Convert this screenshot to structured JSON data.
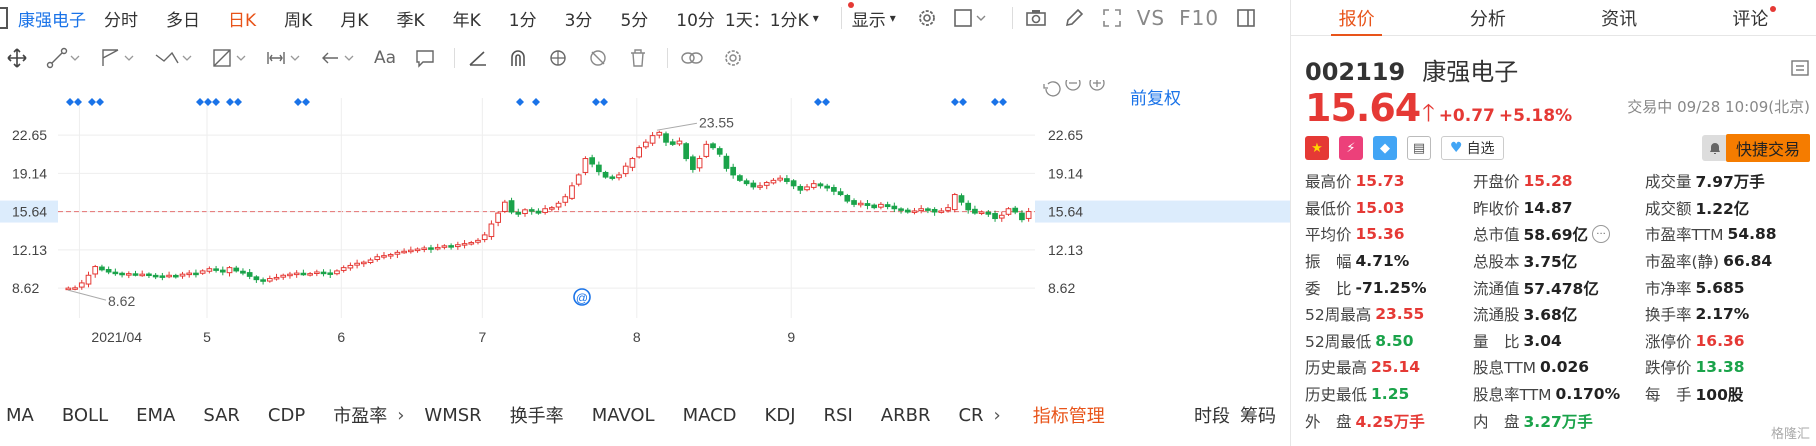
{
  "toolbar": {
    "stock_name": "康强电子",
    "periods": [
      "分时",
      "多日",
      "日K",
      "周K",
      "月K",
      "季K",
      "年K",
      "1分",
      "3分",
      "5分",
      "10分"
    ],
    "active_period": "日K",
    "interval_select": "1天：1分K",
    "display_select": "显示",
    "vs_label": "VS",
    "f10_label": "F10"
  },
  "chart": {
    "adjust_label": "前复权",
    "y_ticks": [
      "22.65",
      "19.14",
      "15.64",
      "12.13",
      "8.62"
    ],
    "current_price_tag": "15.64",
    "x_ticks": [
      "2021/04",
      "5",
      "6",
      "7",
      "8",
      "9"
    ],
    "high_annotation": "23.55",
    "low_annotation": "8.62",
    "event_marker": "@"
  },
  "chart_data": {
    "type": "candlestick",
    "title": "",
    "xlabel": "",
    "ylabel": "",
    "ylim": [
      6.8,
      25.5
    ],
    "x_ticks": [
      "2021/04",
      "5",
      "6",
      "7",
      "8",
      "9"
    ],
    "y_ticks": [
      8.62,
      12.13,
      15.64,
      19.14,
      22.65
    ],
    "reference_line": 15.64,
    "annotations": {
      "max": 23.55,
      "min": 8.62
    },
    "colors": {
      "up": "#e53935",
      "down": "#1aa34a"
    },
    "closes": [
      8.62,
      8.65,
      9.1,
      9.8,
      10.6,
      10.3,
      10.1,
      10.0,
      9.9,
      9.95,
      9.85,
      9.9,
      9.8,
      9.75,
      9.7,
      9.8,
      9.7,
      9.9,
      10.0,
      9.95,
      10.2,
      10.4,
      10.3,
      10.1,
      10.5,
      10.2,
      10.0,
      9.7,
      9.4,
      9.3,
      9.5,
      9.6,
      9.8,
      9.9,
      10.0,
      9.9,
      9.95,
      10.1,
      10.0,
      9.9,
      10.2,
      10.5,
      10.7,
      10.9,
      11.0,
      11.2,
      11.5,
      11.6,
      11.7,
      11.9,
      12.0,
      12.1,
      12.2,
      12.3,
      12.2,
      12.35,
      12.5,
      12.4,
      12.6,
      12.7,
      12.8,
      13.0,
      13.5,
      14.5,
      15.5,
      16.5,
      15.6,
      15.4,
      15.8,
      15.7,
      15.5,
      15.9,
      16.0,
      16.4,
      17.0,
      18.0,
      19.0,
      20.5,
      20.0,
      19.3,
      18.8,
      18.7,
      19.0,
      19.8,
      20.5,
      21.5,
      22.0,
      22.6,
      22.9,
      22.0,
      21.8,
      22.1,
      20.5,
      19.5,
      20.5,
      21.8,
      21.5,
      20.9,
      19.6,
      19.0,
      18.5,
      18.2,
      17.9,
      18.0,
      18.3,
      18.5,
      18.7,
      18.4,
      18.0,
      17.6,
      17.9,
      18.2,
      18.0,
      17.8,
      17.5,
      17.2,
      16.6,
      16.3,
      16.4,
      16.2,
      16.0,
      16.3,
      16.1,
      15.9,
      15.8,
      15.6,
      15.7,
      15.9,
      15.8,
      15.6,
      15.7,
      16.0,
      17.2,
      16.5,
      15.8,
      15.5,
      15.6,
      15.4,
      15.0,
      15.3,
      15.9,
      15.6,
      14.9,
      15.64
    ]
  },
  "indicators": {
    "items": [
      "MA",
      "BOLL",
      "EMA",
      "SAR",
      "CDP",
      "市盈率",
      "WMSR",
      "换手率",
      "MAVOL",
      "MACD",
      "KDJ",
      "RSI",
      "ARBR",
      "CR"
    ],
    "manage": "指标管理",
    "right_items": [
      "时段",
      "筹码"
    ]
  },
  "quote": {
    "tabs": [
      "报价",
      "分析",
      "资讯",
      "评论"
    ],
    "code": "002119",
    "name": "康强电子",
    "price": "15.64",
    "change": "+0.77",
    "change_pct": "+5.18%",
    "status": "交易中 09/28 10:09(北京)",
    "fav_label": "自选",
    "trade_label": "快捷交易",
    "stats": [
      [
        {
          "label": "最高价",
          "value": "15.73",
          "tone": "up"
        },
        {
          "label": "开盘价",
          "value": "15.28",
          "tone": "up"
        },
        {
          "label": "成交量",
          "value": "7.97万手",
          "tone": "neu"
        }
      ],
      [
        {
          "label": "最低价",
          "value": "15.03",
          "tone": "up"
        },
        {
          "label": "昨收价",
          "value": "14.87",
          "tone": "neu"
        },
        {
          "label": "成交额",
          "value": "1.22亿",
          "tone": "neu"
        }
      ],
      [
        {
          "label": "平均价",
          "value": "15.36",
          "tone": "up"
        },
        {
          "label": "总市值",
          "value": "58.69亿",
          "tone": "neu",
          "more": true
        },
        {
          "label": "市盈率TTM",
          "value": "54.88",
          "tone": "neu"
        }
      ],
      [
        {
          "label": "振　幅",
          "value": "4.71%",
          "tone": "neu"
        },
        {
          "label": "总股本",
          "value": "3.75亿",
          "tone": "neu"
        },
        {
          "label": "市盈率(静)",
          "value": "66.84",
          "tone": "neu"
        }
      ],
      [
        {
          "label": "委　比",
          "value": "-71.25%",
          "tone": "neu"
        },
        {
          "label": "流通值",
          "value": "57.478亿",
          "tone": "neu"
        },
        {
          "label": "市净率",
          "value": "5.685",
          "tone": "neu"
        }
      ],
      [
        {
          "label": "52周最高",
          "value": "23.55",
          "tone": "up"
        },
        {
          "label": "流通股",
          "value": "3.68亿",
          "tone": "neu"
        },
        {
          "label": "换手率",
          "value": "2.17%",
          "tone": "neu"
        }
      ],
      [
        {
          "label": "52周最低",
          "value": "8.50",
          "tone": "down"
        },
        {
          "label": "量　比",
          "value": "3.04",
          "tone": "neu"
        },
        {
          "label": "涨停价",
          "value": "16.36",
          "tone": "up"
        }
      ],
      [
        {
          "label": "历史最高",
          "value": "25.14",
          "tone": "up"
        },
        {
          "label": "股息TTM",
          "value": "0.026",
          "tone": "neu"
        },
        {
          "label": "跌停价",
          "value": "13.38",
          "tone": "down"
        }
      ],
      [
        {
          "label": "历史最低",
          "value": "1.25",
          "tone": "down"
        },
        {
          "label": "股息率TTM",
          "value": "0.170%",
          "tone": "neu"
        },
        {
          "label": "每　手",
          "value": "100股",
          "tone": "neu"
        }
      ],
      [
        {
          "label": "外　盘",
          "value": "4.25万手",
          "tone": "up"
        },
        {
          "label": "内　盘",
          "value": "3.27万手",
          "tone": "down"
        }
      ]
    ],
    "watermark": "格隆汇"
  }
}
